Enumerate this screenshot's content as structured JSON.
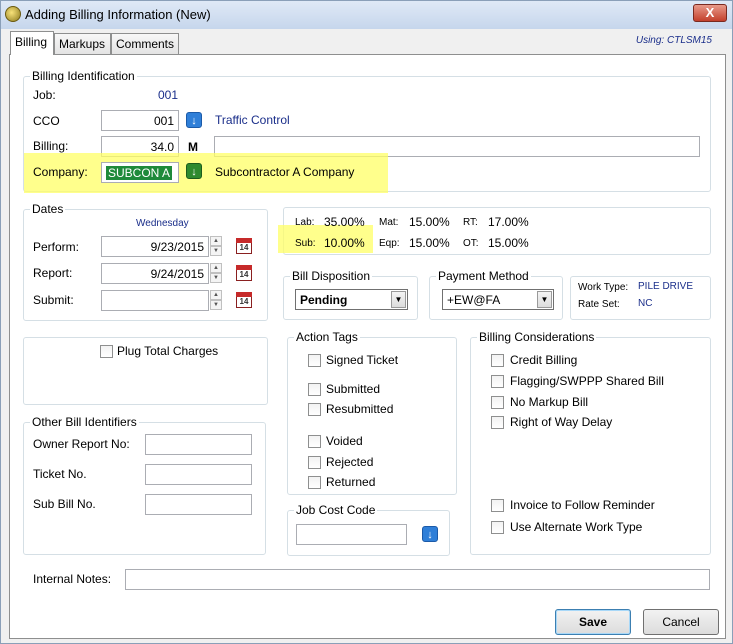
{
  "window": {
    "title": "Adding Billing Information  (New)",
    "close_label": "X"
  },
  "tabs": [
    {
      "label": "Billing"
    },
    {
      "label": "Markups"
    },
    {
      "label": "Comments"
    }
  ],
  "using": "Using:  CTLSM15",
  "billing_identification": {
    "group_label": "Billing Identification",
    "job_label": "Job:",
    "job_value": "001",
    "cco_label": "CCO",
    "cco_value": "001",
    "cco_description": "Traffic Control",
    "billing_label": "Billing:",
    "billing_value": "34.0",
    "billing_unit": "M",
    "billing_note": "",
    "company_label": "Company:",
    "company_value": "SUBCON A",
    "company_name": "Subcontractor A Company"
  },
  "dates": {
    "group_label": "Dates",
    "weekday": "Wednesday",
    "perform_label": "Perform:",
    "perform_value": "9/23/2015",
    "report_label": "Report:",
    "report_value": "9/24/2015",
    "submit_label": "Submit:",
    "submit_value": "",
    "calendar_day": "14"
  },
  "rates": [
    {
      "label": "Lab:",
      "value": "35.00%"
    },
    {
      "label": "Mat:",
      "value": "15.00%"
    },
    {
      "label": "RT:",
      "value": "17.00%"
    },
    {
      "label": "Sub:",
      "value": "10.00%"
    },
    {
      "label": "Eqp:",
      "value": "15.00%"
    },
    {
      "label": "OT:",
      "value": "15.00%"
    }
  ],
  "bill_disposition": {
    "group_label": "Bill Disposition",
    "value": "Pending"
  },
  "payment_method": {
    "group_label": "Payment Method",
    "value": "+EW@FA"
  },
  "work_info": {
    "work_type_label": "Work Type:",
    "work_type_value": "PILE DRIVE",
    "rate_set_label": "Rate Set:",
    "rate_set_value": "NC"
  },
  "plug_total": {
    "label": "Plug Total Charges"
  },
  "action_tags": {
    "group_label": "Action Tags",
    "items": [
      "Signed Ticket",
      "Submitted",
      "Resubmitted",
      "Voided",
      "Rejected",
      "Returned"
    ]
  },
  "billing_considerations": {
    "group_label": "Billing Considerations",
    "items": [
      "Credit Billing",
      "Flagging/SWPPP Shared Bill",
      "No Markup Bill",
      "Right of Way Delay",
      "Invoice to Follow Reminder",
      "Use Alternate Work Type"
    ]
  },
  "other_identifiers": {
    "group_label": "Other Bill Identifiers",
    "owner_report_label": "Owner Report No:",
    "ticket_label": "Ticket No.",
    "sub_bill_label": "Sub Bill No."
  },
  "job_cost_code": {
    "group_label": "Job Cost Code",
    "value": ""
  },
  "internal_notes": {
    "label": "Internal Notes:",
    "value": ""
  },
  "buttons": {
    "save": "Save",
    "cancel": "Cancel"
  },
  "colors": {
    "accent": "#1a2e8a",
    "highlight": "#ffff66",
    "selection": "#1e8a3a"
  }
}
